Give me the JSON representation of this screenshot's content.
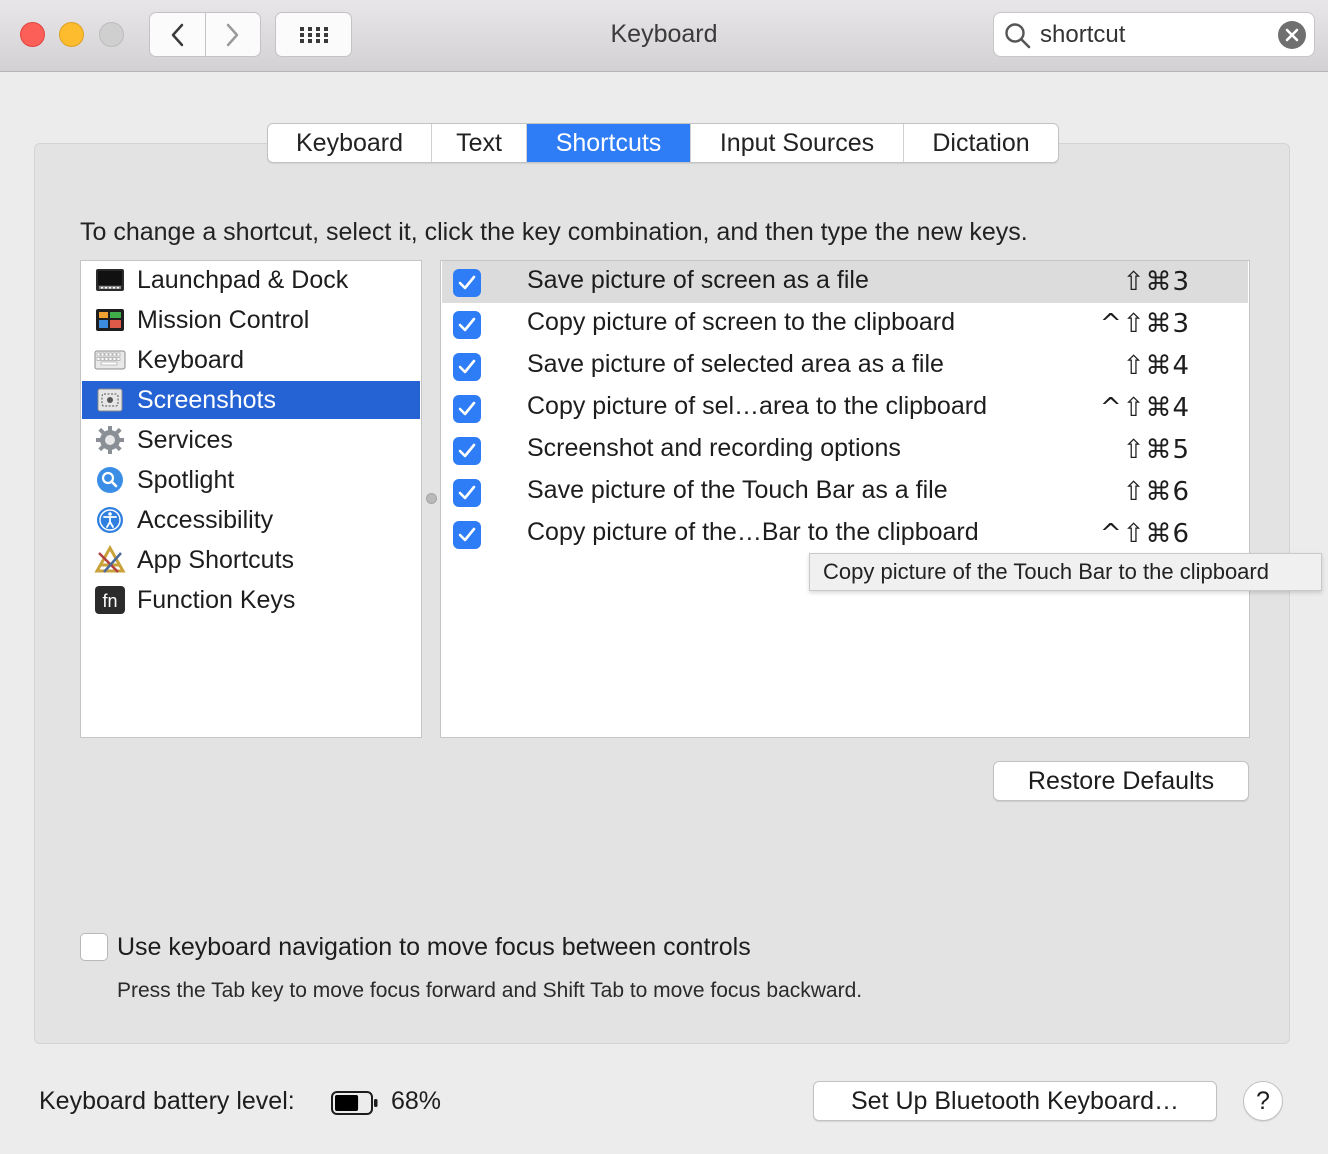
{
  "window": {
    "title": "Keyboard"
  },
  "search": {
    "value": "shortcut"
  },
  "tabs": [
    {
      "label": "Keyboard",
      "active": false
    },
    {
      "label": "Text",
      "active": false
    },
    {
      "label": "Shortcuts",
      "active": true
    },
    {
      "label": "Input Sources",
      "active": false
    },
    {
      "label": "Dictation",
      "active": false
    }
  ],
  "instruction": "To change a shortcut, select it, click the key combination, and then type the new keys.",
  "categories": [
    {
      "label": "Launchpad & Dock",
      "icon": "launchpad-dock-icon"
    },
    {
      "label": "Mission Control",
      "icon": "mission-control-icon"
    },
    {
      "label": "Keyboard",
      "icon": "keyboard-icon"
    },
    {
      "label": "Screenshots",
      "icon": "screenshots-icon",
      "selected": true
    },
    {
      "label": "Services",
      "icon": "gear-icon"
    },
    {
      "label": "Spotlight",
      "icon": "spotlight-icon"
    },
    {
      "label": "Accessibility",
      "icon": "accessibility-icon"
    },
    {
      "label": "App Shortcuts",
      "icon": "app-shortcuts-icon"
    },
    {
      "label": "Function Keys",
      "icon": "fn-key-icon"
    }
  ],
  "shortcuts": [
    {
      "checked": true,
      "label": "Save picture of screen as a file",
      "keys": "⇧⌘3",
      "highlighted": true
    },
    {
      "checked": true,
      "label": "Copy picture of screen to the clipboard",
      "keys": "^⇧⌘3"
    },
    {
      "checked": true,
      "label": "Save picture of selected area as a file",
      "keys": "⇧⌘4"
    },
    {
      "checked": true,
      "label": "Copy picture of sel…area to the clipboard",
      "keys": "^⇧⌘4"
    },
    {
      "checked": true,
      "label": "Screenshot and recording options",
      "keys": "⇧⌘5"
    },
    {
      "checked": true,
      "label": "Save picture of the Touch Bar as a file",
      "keys": "⇧⌘6"
    },
    {
      "checked": true,
      "label": "Copy picture of the…Bar to the clipboard",
      "keys": "^⇧⌘6"
    }
  ],
  "tooltip": "Copy picture of the Touch Bar to the clipboard",
  "restore_defaults": "Restore Defaults",
  "keyboard_nav": {
    "checked": false,
    "label": "Use keyboard navigation to move focus between controls",
    "hint": "Press the Tab key to move focus forward and Shift Tab to move focus backward."
  },
  "battery": {
    "label": "Keyboard battery level:",
    "value": "68%",
    "level": 0.68
  },
  "bluetooth_button": "Set Up Bluetooth Keyboard…",
  "help_button": "?",
  "colors": {
    "accent": "#2e7cf6",
    "selection": "#2562d3"
  }
}
